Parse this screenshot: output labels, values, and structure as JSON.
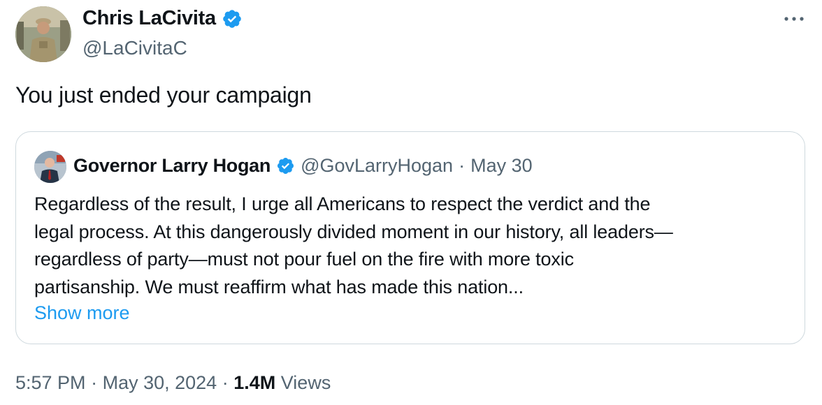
{
  "tweet": {
    "author": {
      "name": "Chris LaCivita",
      "handle": "@LaCivitaC",
      "verified": true,
      "avatar_icon": "profile-photo"
    },
    "more_icon": "more-horizontal-icon",
    "text": "You just ended your campaign",
    "quote": {
      "author_name": "Governor Larry Hogan",
      "verified": true,
      "handle": "@GovLarryHogan",
      "separator": "·",
      "date": "May 30",
      "lines": [
        "Regardless of the result, I urge all Americans to respect the verdict and the",
        "legal process. At this dangerously divided moment in our history, all leaders—",
        "regardless of party—must not pour fuel on the fire with more toxic",
        "partisanship. We must reaffirm what has made this nation..."
      ],
      "show_more": "Show more"
    },
    "footer": {
      "time": "5:57 PM",
      "sep1": "·",
      "date": "May 30, 2024",
      "sep2": "·",
      "views_count": "1.4M",
      "views_label": "Views"
    }
  },
  "colors": {
    "text": "#0f1419",
    "secondary": "#536471",
    "link": "#1d9bf0",
    "verified": "#1d9bf0",
    "border": "#cfd9de"
  }
}
